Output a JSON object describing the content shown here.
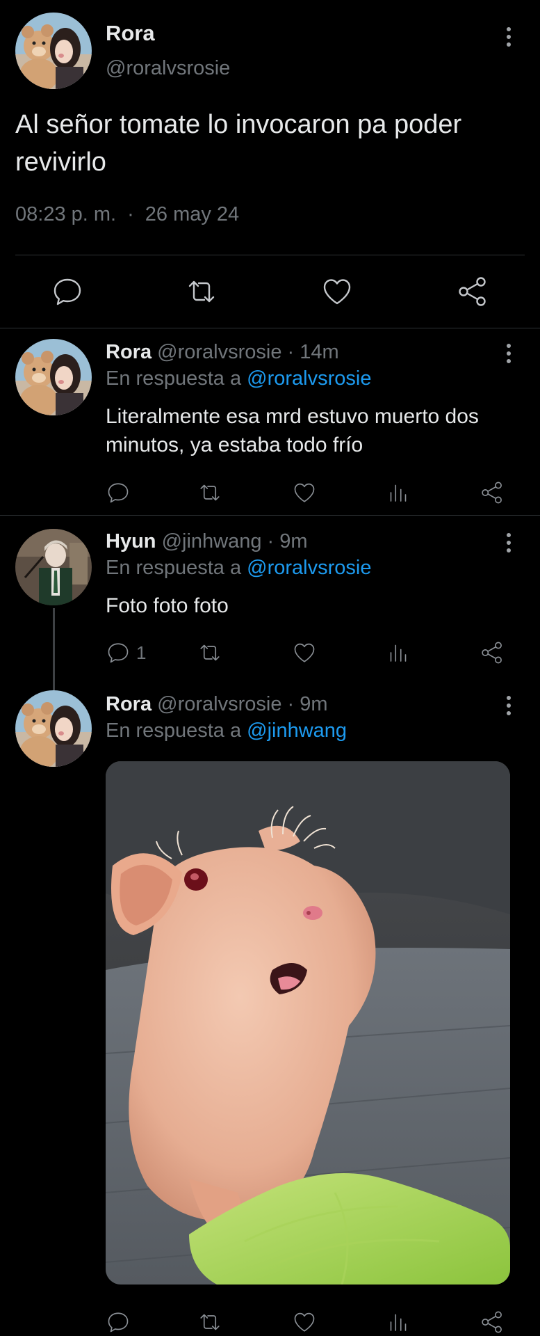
{
  "main_tweet": {
    "author_name": "Rora",
    "author_handle": "@roralvsrosie",
    "text": "Al señor tomate lo invocaron pa poder revivirlo",
    "time": "08:23 p. m.",
    "separator": "·",
    "date": "26 may 24",
    "actions": [
      "reply-icon",
      "retweet-icon",
      "like-icon",
      "share-icon"
    ]
  },
  "replies": [
    {
      "author_name": "Rora",
      "author_handle": "@roralvsrosie",
      "age": "· 14m",
      "reply_prefix": "En respuesta a",
      "reply_to": "@roralvsrosie",
      "text": "Literalmente esa mrd estuvo muerto dos minutos, ya estaba todo frío",
      "reply_count": ""
    },
    {
      "author_name": "Hyun",
      "author_handle": "@jinhwang",
      "age": "· 9m",
      "reply_prefix": "En respuesta a",
      "reply_to": "@roralvsrosie",
      "text": "Foto foto foto",
      "reply_count": "1"
    },
    {
      "author_name": "Rora",
      "author_handle": "@roralvsrosie",
      "age": "· 9m",
      "reply_prefix": "En respuesta a",
      "reply_to": "@jinhwang",
      "text": "",
      "reply_count": "",
      "media": "hairless-guinea-pig-photo"
    }
  ],
  "colors": {
    "background": "#000000",
    "text": "#e7e9ea",
    "muted": "#71767b",
    "link": "#1d9bf0",
    "divider": "#2f3336"
  }
}
